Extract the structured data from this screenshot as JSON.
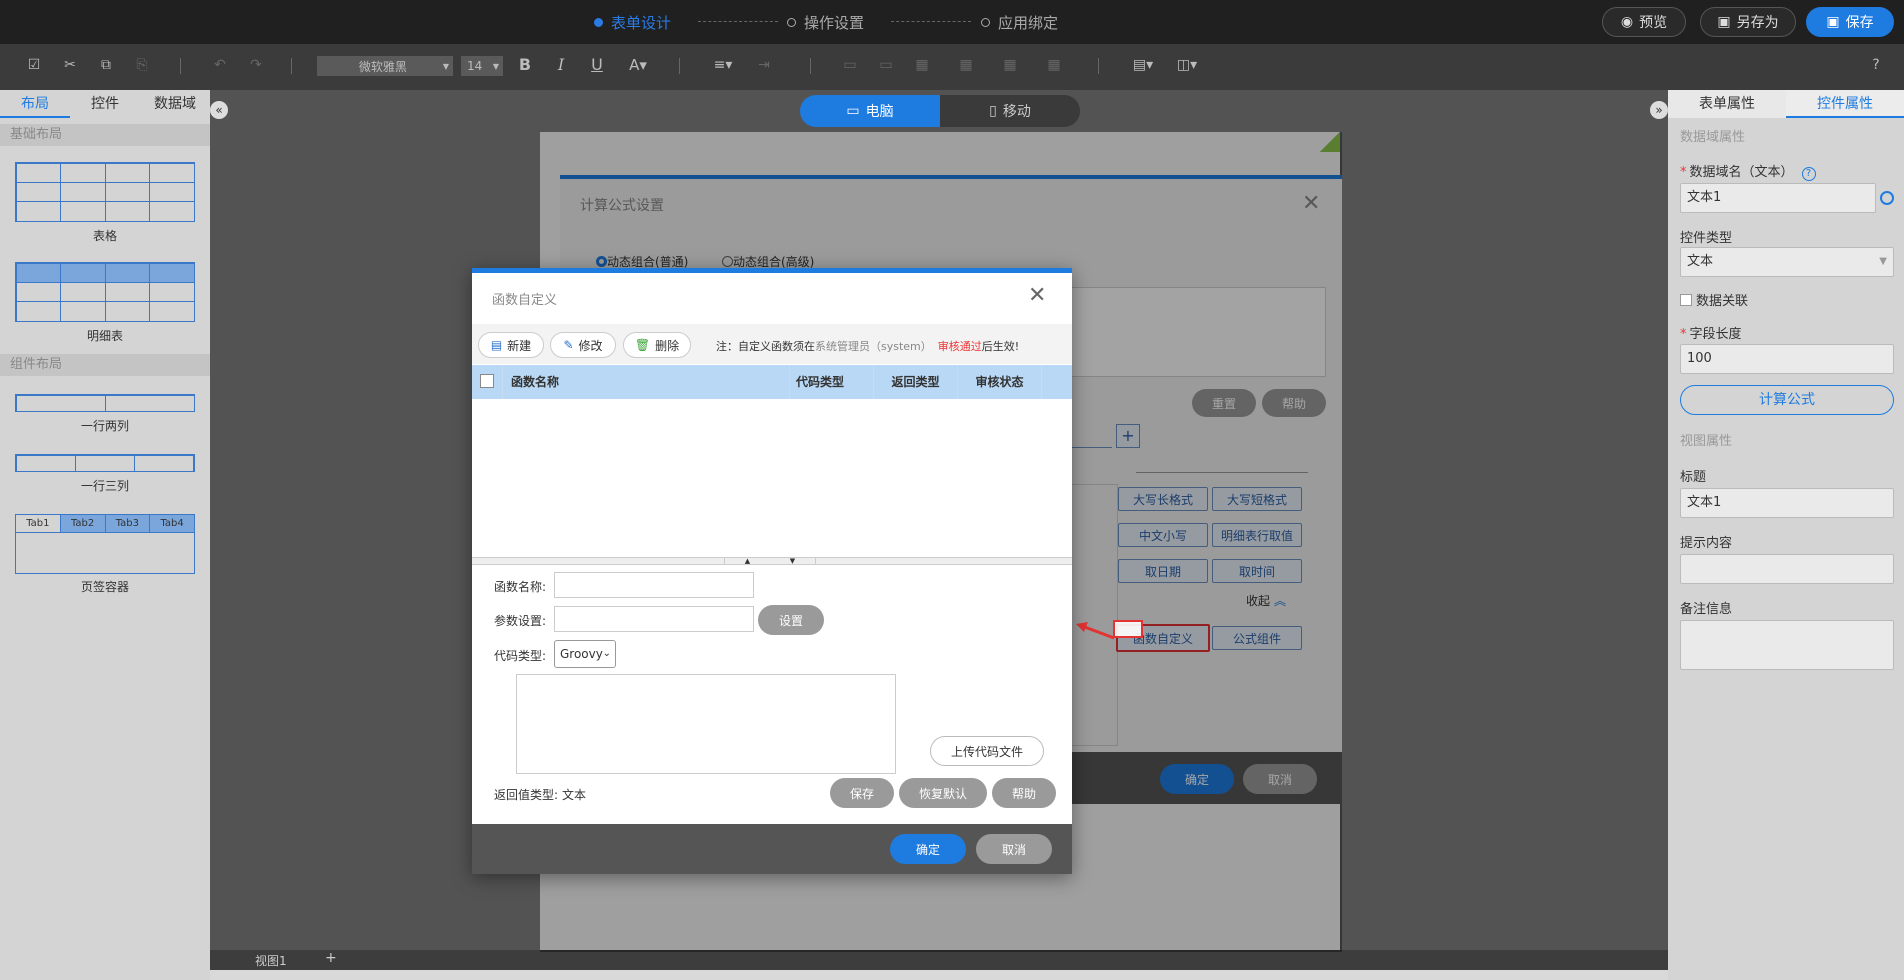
{
  "steps": [
    "表单设计",
    "操作设置",
    "应用绑定"
  ],
  "topbar": {
    "preview": "预览",
    "save_as": "另存为",
    "save": "保存"
  },
  "toolbar": {
    "font_name": "微软雅黑",
    "font_size": "14",
    "help_icon": "question-icon"
  },
  "left_panel": {
    "tabs": [
      "布局",
      "控件",
      "数据域"
    ],
    "sections": [
      "基础布局",
      "组件布局"
    ],
    "items": [
      "表格",
      "明细表",
      "一行两列",
      "一行三列",
      "页签容器"
    ],
    "tab_labels": [
      "Tab1",
      "Tab2",
      "Tab3",
      "Tab4"
    ]
  },
  "device_tabs": [
    "电脑",
    "移动"
  ],
  "bottom": {
    "view_tab": "视图1",
    "add": "+"
  },
  "right_panel": {
    "tabs": [
      "表单属性",
      "控件属性"
    ],
    "data_section": "数据域属性",
    "data_name_label": "数据域名（文本）",
    "data_name_value": "文本1",
    "control_type_label": "控件类型",
    "control_type_value": "文本",
    "data_link_label": "数据关联",
    "field_length_label": "字段长度",
    "field_length_value": "100",
    "formula_button": "计算公式",
    "view_section": "视图属性",
    "title_label": "标题",
    "title_value": "文本1",
    "hint_label": "提示内容",
    "hint_value": "",
    "note_label": "备注信息"
  },
  "formula_dialog": {
    "title": "计算公式设置",
    "radio1": "动态组合(普通)",
    "radio2": "动态组合(高级)",
    "reset": "重置",
    "help": "帮助",
    "plus": "+",
    "fn_buttons": [
      "大写长格式",
      "大写短格式",
      "中文小写",
      "明细表行取值",
      "取日期",
      "取时间"
    ],
    "collapse": "收起",
    "custom_fn": "函数自定义",
    "formula_component": "公式组件",
    "ok": "确定",
    "cancel": "取消"
  },
  "fn_dialog": {
    "title": "函数自定义",
    "new": "新建",
    "edit": "修改",
    "delete": "删除",
    "note_prefix": "注：自定义函数须在",
    "note_admin": "系统管理员（system）",
    "note_approved": "审核通过",
    "note_suffix": "后生效!",
    "columns": [
      "函数名称",
      "代码类型",
      "返回类型",
      "审核状态"
    ],
    "rows": [],
    "name_label": "函数名称:",
    "name_value": "",
    "param_label": "参数设置:",
    "param_value": "",
    "set_button": "设置",
    "code_type_label": "代码类型:",
    "code_type_value": "Groovy",
    "upload_button": "上传代码文件",
    "return_type_label": "返回值类型:",
    "return_type_value": "文本",
    "save": "保存",
    "restore": "恢复默认",
    "help": "帮助",
    "ok": "确定",
    "cancel": "取消"
  },
  "colors": {
    "accent": "#1e7be0",
    "highlight": "#e33333",
    "header_bg": "#b8d8f5"
  }
}
